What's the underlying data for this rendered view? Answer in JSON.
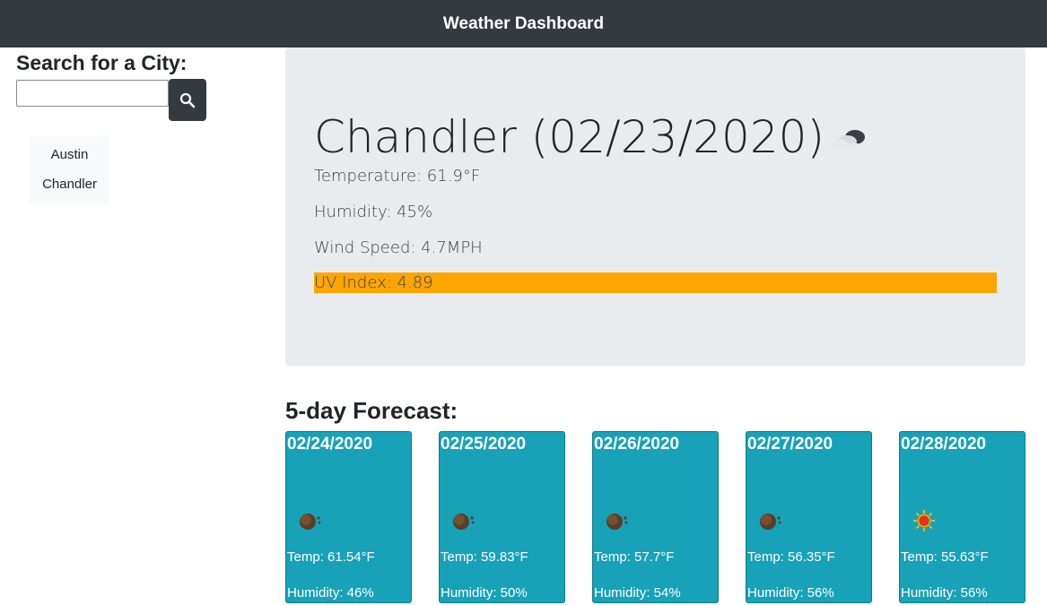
{
  "header": {
    "title": "Weather Dashboard"
  },
  "sidebar": {
    "heading": "Search for a City:",
    "search_value": "",
    "search_button_icon": "search-icon",
    "history": [
      "Austin",
      "Chandler"
    ]
  },
  "current": {
    "title": "Chandler (02/23/2020)",
    "icon": "cloud-icon",
    "temperature": "Temperature: 61.9°F",
    "humidity": "Humidity: 45%",
    "wind": "Wind Speed: 4.7MPH",
    "uv": "UV Index: 4.89",
    "uv_color": "#ffa500"
  },
  "forecast": {
    "heading": "5-day Forecast:",
    "days": [
      {
        "date": "02/24/2020",
        "icon": "haze-icon",
        "temp": "Temp: 61.54°F",
        "humidity": "Humidity: 46%"
      },
      {
        "date": "02/25/2020",
        "icon": "haze-icon",
        "temp": "Temp: 59.83°F",
        "humidity": "Humidity: 50%"
      },
      {
        "date": "02/26/2020",
        "icon": "haze-icon",
        "temp": "Temp: 57.7°F",
        "humidity": "Humidity: 54%"
      },
      {
        "date": "02/27/2020",
        "icon": "haze-icon",
        "temp": "Temp: 56.35°F",
        "humidity": "Humidity: 56%"
      },
      {
        "date": "02/28/2020",
        "icon": "sun-icon",
        "temp": "Temp: 55.63°F",
        "humidity": "Humidity: 56%"
      }
    ]
  },
  "colors": {
    "navbar": "#343a40",
    "card": "#17a2b8",
    "jumbotron": "#e9ecef"
  }
}
